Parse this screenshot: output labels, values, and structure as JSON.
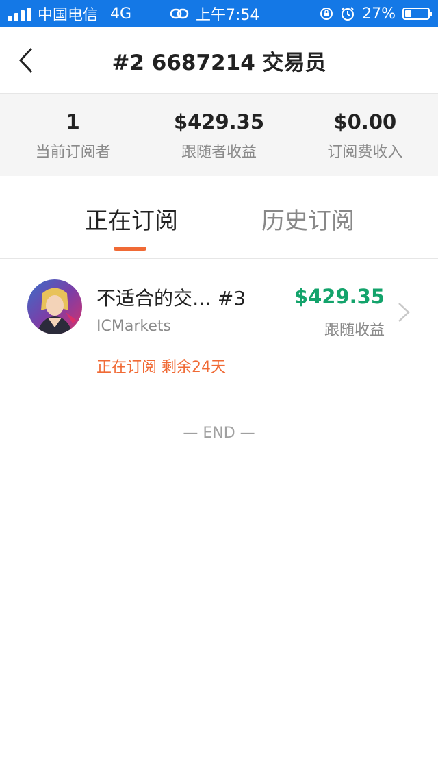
{
  "status_bar": {
    "carrier": "中国电信",
    "network": "4G",
    "time": "上午7:54",
    "battery": "27%",
    "battery_level": 0.27,
    "icons": [
      "signal-icon",
      "link-icon",
      "rotation-lock-icon",
      "alarm-icon",
      "battery-icon"
    ]
  },
  "nav": {
    "title": "#2 6687214 交易员",
    "back_icon": "chevron-left-icon"
  },
  "stats": [
    {
      "value": "1",
      "label": "当前订阅者"
    },
    {
      "value": "$429.35",
      "label": "跟随者收益"
    },
    {
      "value": "$0.00",
      "label": "订阅费收入"
    }
  ],
  "tabs": [
    {
      "label": "正在订阅",
      "active": true
    },
    {
      "label": "历史订阅",
      "active": false
    }
  ],
  "subscriptions": [
    {
      "name": "不适合的交… #3",
      "broker": "ICMarkets",
      "status": "正在订阅 剩余24天",
      "amount": "$429.35",
      "amount_label": "跟随收益"
    }
  ],
  "end_marker": "— END —",
  "colors": {
    "status_bar": "#1478e6",
    "accent": "#f06a35",
    "profit": "#13a36b"
  }
}
